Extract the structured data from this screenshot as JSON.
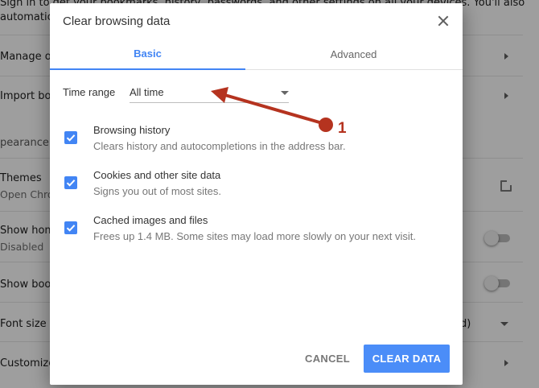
{
  "background": {
    "rows": [
      {
        "text": "Sign in to get your bookmarks, history, passwords, and other settings on all your devices. You'll also",
        "sub": "automatica"
      },
      {
        "text": "Manage oth"
      },
      {
        "text": "Import boo"
      },
      {
        "section": "pearance"
      },
      {
        "text": "Themes",
        "sub": "Open Chro"
      },
      {
        "text": "Show home",
        "sub": "Disabled"
      },
      {
        "text": "Show book"
      },
      {
        "text": "Font size",
        "value": "d)"
      },
      {
        "text": "Customize"
      }
    ]
  },
  "dialog": {
    "title": "Clear browsing data",
    "tabs": [
      {
        "label": "Basic",
        "active": true
      },
      {
        "label": "Advanced",
        "active": false
      }
    ],
    "time_range": {
      "label": "Time range",
      "value": "All time"
    },
    "options": [
      {
        "title": "Browsing history",
        "desc": "Clears history and autocompletions in the address bar.",
        "checked": true
      },
      {
        "title": "Cookies and other site data",
        "desc": "Signs you out of most sites.",
        "checked": true
      },
      {
        "title": "Cached images and files",
        "desc": "Frees up 1.4 MB. Some sites may load more slowly on your next visit.",
        "checked": true
      }
    ],
    "buttons": {
      "cancel": "CANCEL",
      "clear": "CLEAR DATA"
    }
  },
  "annotation": {
    "label": "1",
    "color": "#b5331f"
  },
  "colors": {
    "accent": "#4285f4",
    "clear_button": "#4b8df8"
  }
}
